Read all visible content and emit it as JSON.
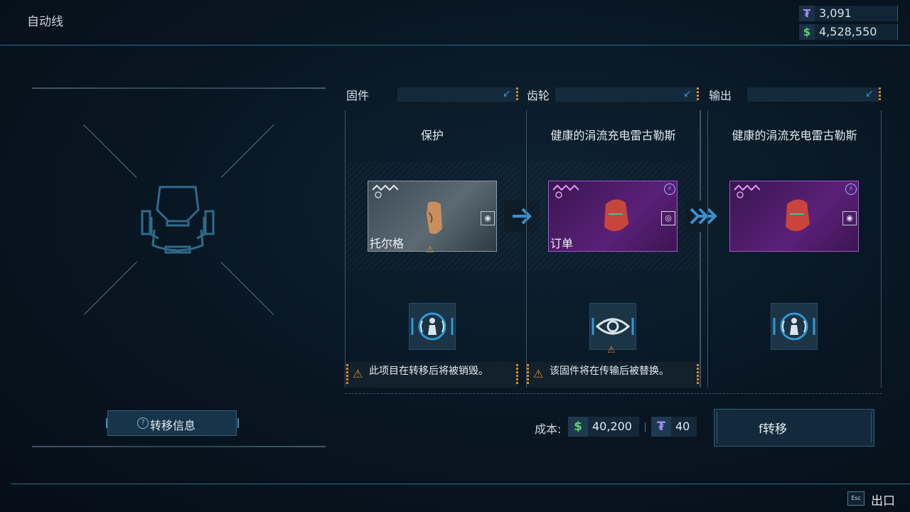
{
  "header": {
    "title": "自动线"
  },
  "currency": {
    "tokens": "3,091",
    "money": "4,528,550",
    "token_symbol": "₮",
    "money_symbol": "$"
  },
  "slots": [
    {
      "header": "固件",
      "item_name": "保护",
      "card_label": "托尔格",
      "warning": "此项目在转移后将被销毁。",
      "icon": "empathy-icon"
    },
    {
      "header": "齿轮",
      "item_name": "健康的涓流充电雷古勒斯",
      "card_label": "订单",
      "warning": "该固件将在传输后被替换。",
      "icon": "eye-icon"
    },
    {
      "header": "输出",
      "item_name": "健康的涓流充电雷古勒斯",
      "card_label": "",
      "warning": "",
      "icon": "empathy-icon"
    }
  ],
  "transfer_info": {
    "label": "转移信息"
  },
  "cost": {
    "label": "成本:",
    "money": "40,200",
    "tokens": "40"
  },
  "transfer_button": {
    "label": "f转移"
  },
  "footer": {
    "esc_key": "Esc",
    "exit_label": "出口"
  },
  "colors": {
    "accent": "#2b6f8f",
    "warning": "#d58a2a",
    "rare_purple": "#a552d6",
    "money_green": "#5fd36c",
    "token_purple": "#a98ff5"
  }
}
